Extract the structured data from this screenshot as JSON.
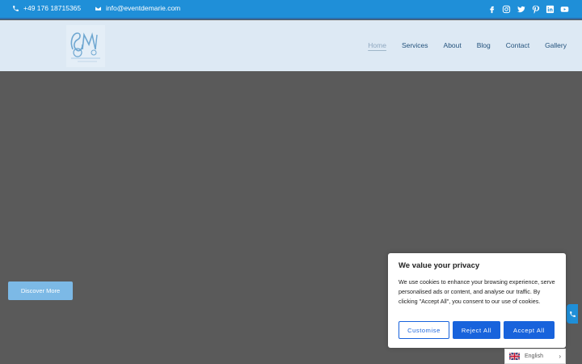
{
  "topbar": {
    "phone": "+49 176 18715365",
    "email": "info@eventdemarie.com",
    "socials": [
      "facebook-icon",
      "instagram-icon",
      "twitter-icon",
      "pinterest-icon",
      "linkedin-icon",
      "youtube-icon"
    ]
  },
  "nav": {
    "items": [
      {
        "label": "Home",
        "active": true
      },
      {
        "label": "Services",
        "active": false
      },
      {
        "label": "About",
        "active": false
      },
      {
        "label": "Blog",
        "active": false
      },
      {
        "label": "Contact",
        "active": false
      },
      {
        "label": "Gallery",
        "active": false
      }
    ]
  },
  "hero": {
    "cta_label": "Discover More"
  },
  "cookie": {
    "title": "We value your privacy",
    "body": "We use cookies to enhance your browsing experience, serve personalised ads or content, and analyse our traffic. By clicking \"Accept All\", you consent to our use of cookies.",
    "customise_label": "Customise",
    "reject_label": "Reject All",
    "accept_label": "Accept All"
  },
  "language": {
    "selected": "English"
  },
  "colors": {
    "topbar": "#1f8fd8",
    "header": "#dde9f4",
    "hero": "#5a5a5a",
    "cookie_button": "#1863dc",
    "cta": "#7cb9e6"
  }
}
